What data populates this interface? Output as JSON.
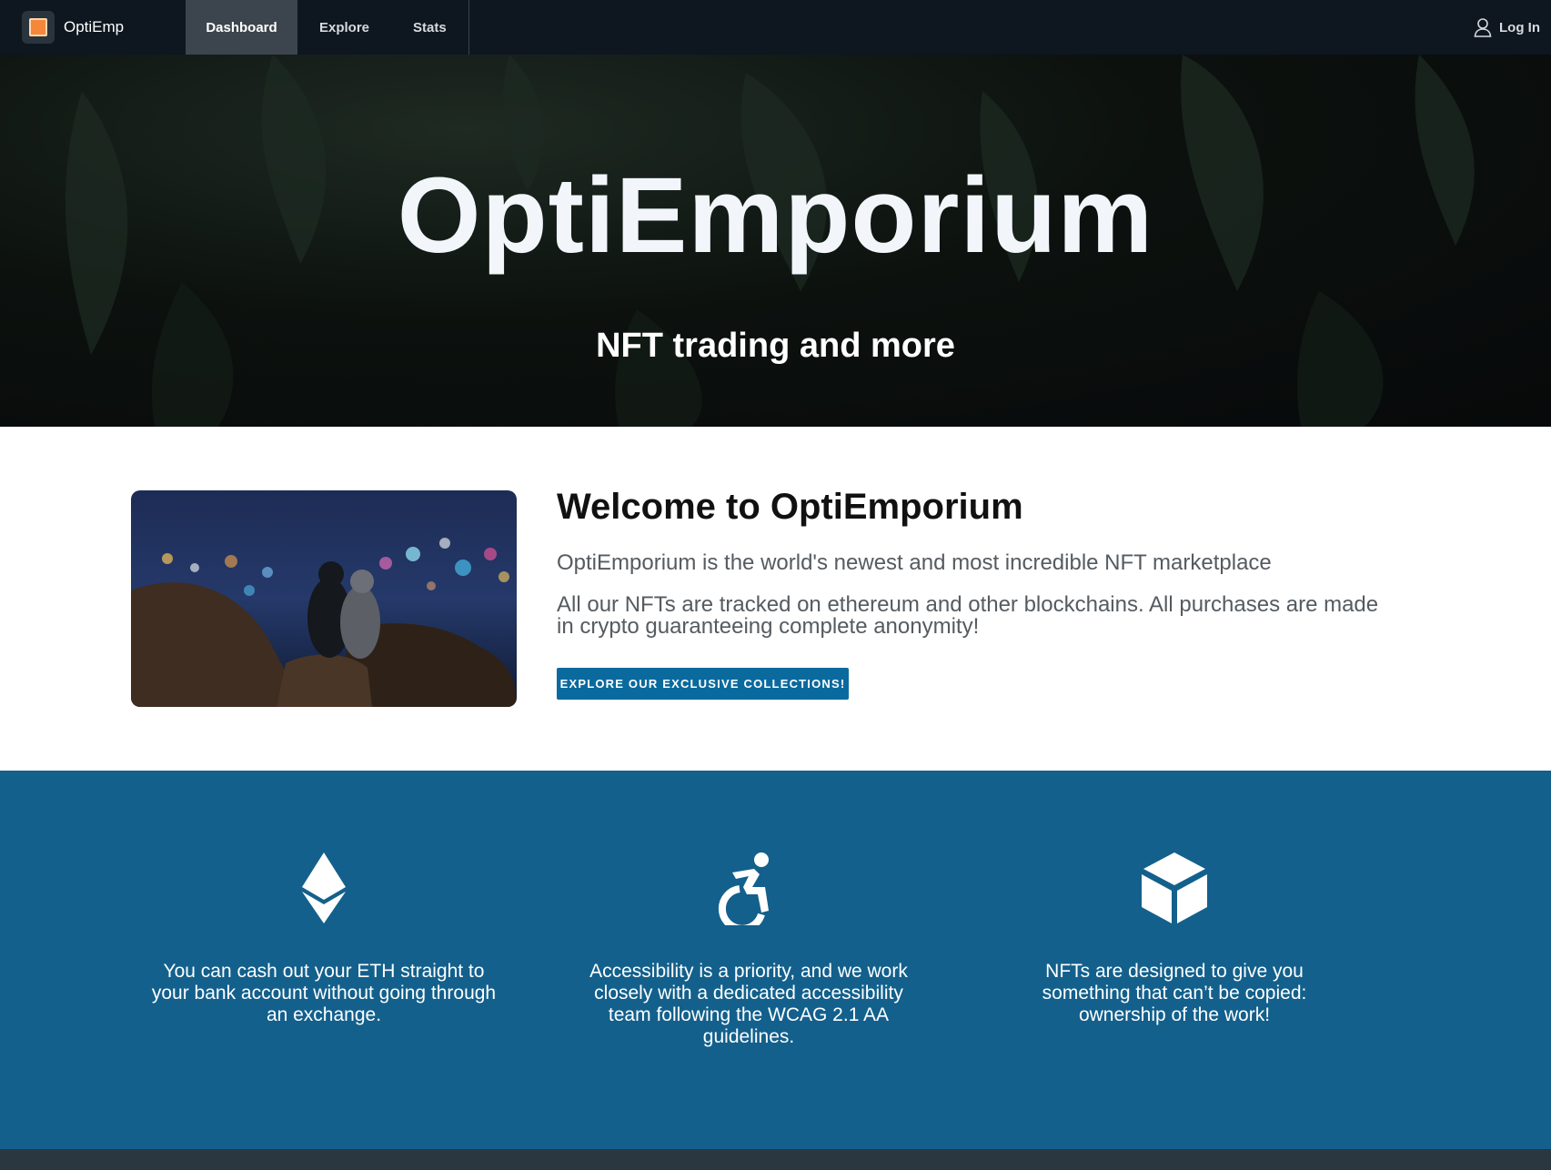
{
  "nav": {
    "brand": "OptiEmp",
    "tabs": [
      {
        "label": "Dashboard",
        "active": true
      },
      {
        "label": "Explore",
        "active": false
      },
      {
        "label": "Stats",
        "active": false
      }
    ],
    "login_label": "Log In",
    "login_icon": "user-icon"
  },
  "hero": {
    "title": "OptiEmporium",
    "subtitle": "NFT trading and more"
  },
  "welcome": {
    "title": "Welcome to OptiEmporium",
    "paragraph1": "OptiEmporium is the world's newest and most incredible NFT marketplace",
    "paragraph2": "All our NFTs are tracked on ethereum and other blockchains. All purchases are made in crypto guaranteeing complete anonymity!",
    "button_label": "EXPLORE OUR EXCLUSIVE COLLECTIONS!"
  },
  "features": [
    {
      "icon": "ethereum-icon",
      "text": "You can cash out your ETH straight to your bank account without going through an exchange."
    },
    {
      "icon": "accessibility-icon",
      "text": "Accessibility is a priority, and we work closely with a dedicated accessibility team following the WCAG 2.1 AA guidelines."
    },
    {
      "icon": "cube-icon",
      "text": "NFTs are designed to give you something that can’t be copied: ownership of the work!"
    }
  ],
  "colors": {
    "nav_bg": "#0e161f",
    "button": "#0a6a9e",
    "features_bg": "#13608c",
    "logo_accent": "#f5873a"
  }
}
